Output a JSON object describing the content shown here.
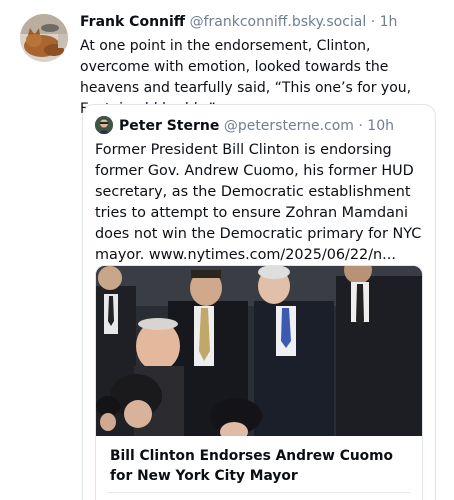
{
  "post": {
    "author_name": "Frank Conniff",
    "author_handle": "@frankconniff.bsky.social",
    "separator": "·",
    "time": "1h",
    "text": "At one point in the endorsement, Clinton, overcome with emotion, looked towards the heavens and tearfully said, “This one’s for you, Epstein old buddy.”"
  },
  "quote": {
    "author_name": "Peter Sterne",
    "author_handle": "@petersterne.com",
    "separator": "·",
    "time": "10h",
    "text": "Former President Bill Clinton is endorsing former Gov. Andrew Cuomo, his former HUD secretary, as the Democratic establishment tries to attempt to ensure Zohran Mamdani does not win the Democratic primary for NYC mayor. www.nytimes.com/2025/06/22/n...",
    "card": {
      "title": "Bill Clinton Endorses Andrew Cuomo for New York City Mayor"
    }
  },
  "icons": {
    "author_avatar": "cat-avatar",
    "quote_avatar": "person-avatar"
  }
}
